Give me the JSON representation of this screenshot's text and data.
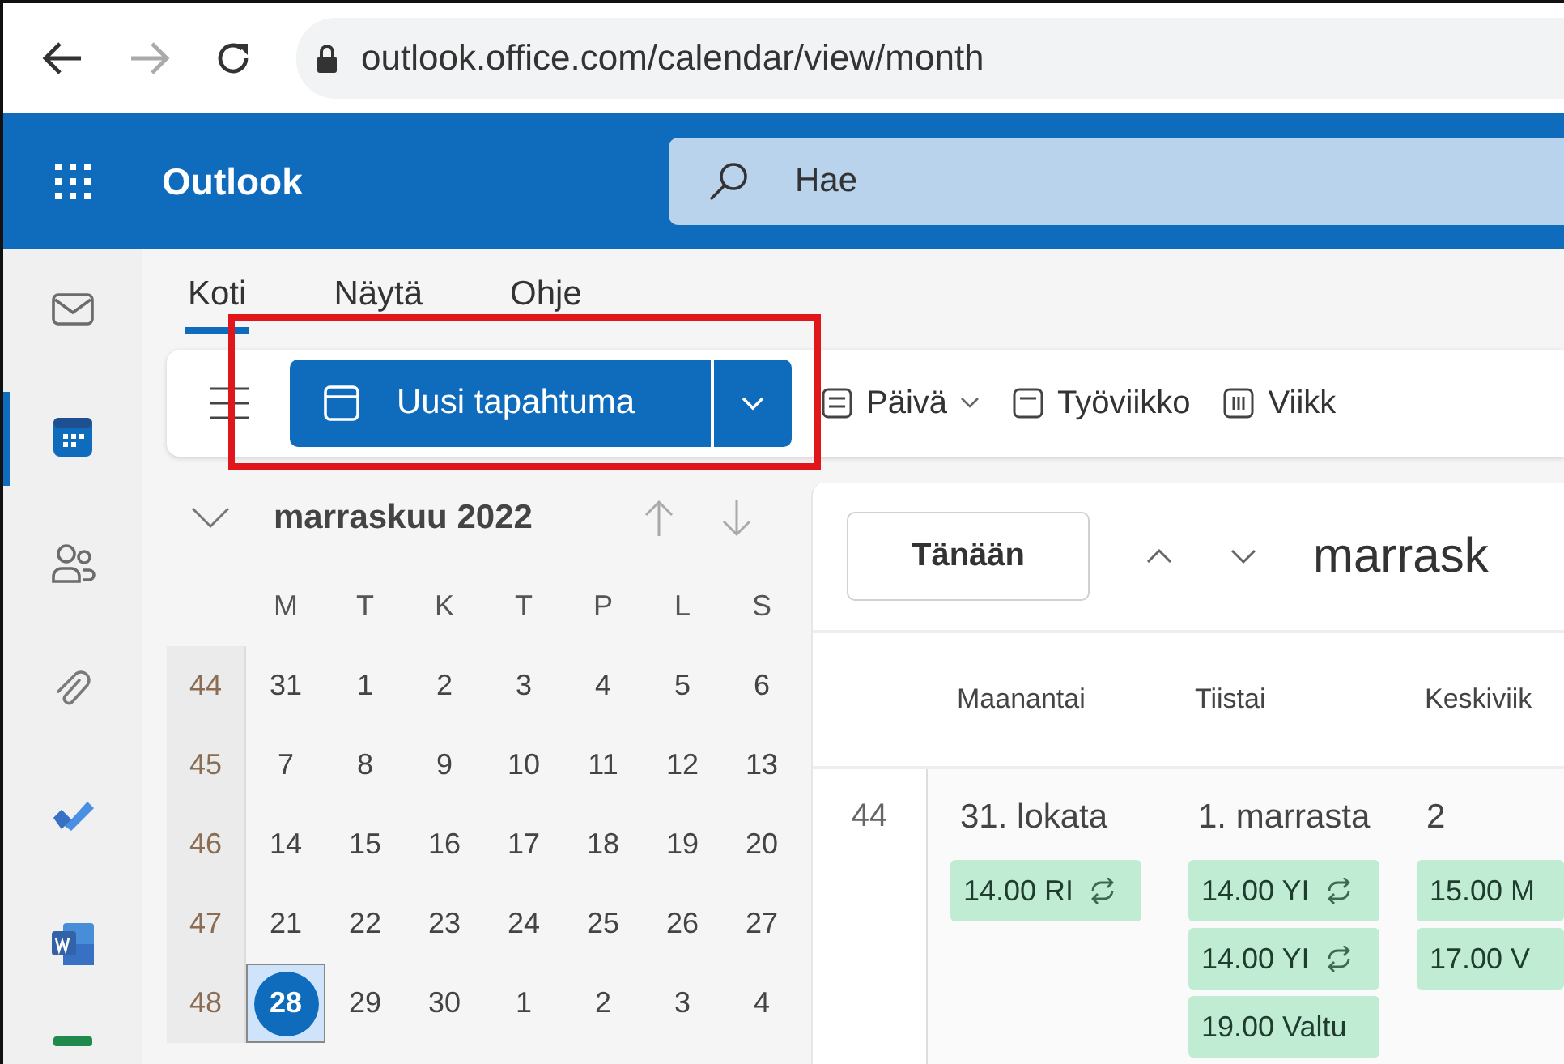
{
  "browser": {
    "url": "outlook.office.com/calendar/view/month"
  },
  "header": {
    "app_name": "Outlook",
    "search": {
      "placeholder": "Hae"
    }
  },
  "rail": [
    {
      "kind": "mail",
      "selected": false
    },
    {
      "kind": "calendar",
      "selected": true
    },
    {
      "kind": "people",
      "selected": false
    },
    {
      "kind": "attach",
      "selected": false
    },
    {
      "kind": "todo",
      "selected": false
    },
    {
      "kind": "word",
      "selected": false
    }
  ],
  "tabs": [
    {
      "label": "Koti",
      "selected": true
    },
    {
      "label": "Näytä",
      "selected": false
    },
    {
      "label": "Ohje",
      "selected": false
    }
  ],
  "toolbar": {
    "new_event": "Uusi tapahtuma",
    "views": [
      {
        "label": "Päivä",
        "kind": "day",
        "dropdown": true
      },
      {
        "label": "Työviikko",
        "kind": "workweek",
        "dropdown": false
      },
      {
        "label": "Viikk",
        "kind": "week",
        "dropdown": false
      }
    ]
  },
  "mini_calendar": {
    "title": "marraskuu 2022",
    "weekdays": [
      "M",
      "T",
      "K",
      "T",
      "P",
      "L",
      "S"
    ],
    "weeks": [
      {
        "number": "44",
        "days": [
          {
            "day": "31",
            "selected": false
          },
          {
            "day": "1",
            "selected": false
          },
          {
            "day": "2",
            "selected": false
          },
          {
            "day": "3",
            "selected": false
          },
          {
            "day": "4",
            "selected": false
          },
          {
            "day": "5",
            "selected": false
          },
          {
            "day": "6",
            "selected": false
          }
        ]
      },
      {
        "number": "45",
        "days": [
          {
            "day": "7",
            "selected": false
          },
          {
            "day": "8",
            "selected": false
          },
          {
            "day": "9",
            "selected": false
          },
          {
            "day": "10",
            "selected": false
          },
          {
            "day": "11",
            "selected": false
          },
          {
            "day": "12",
            "selected": false
          },
          {
            "day": "13",
            "selected": false
          }
        ]
      },
      {
        "number": "46",
        "days": [
          {
            "day": "14",
            "selected": false
          },
          {
            "day": "15",
            "selected": false
          },
          {
            "day": "16",
            "selected": false
          },
          {
            "day": "17",
            "selected": false
          },
          {
            "day": "18",
            "selected": false
          },
          {
            "day": "19",
            "selected": false
          },
          {
            "day": "20",
            "selected": false
          }
        ]
      },
      {
        "number": "47",
        "days": [
          {
            "day": "21",
            "selected": false
          },
          {
            "day": "22",
            "selected": false
          },
          {
            "day": "23",
            "selected": false
          },
          {
            "day": "24",
            "selected": false
          },
          {
            "day": "25",
            "selected": false
          },
          {
            "day": "26",
            "selected": false
          },
          {
            "day": "27",
            "selected": false
          }
        ]
      },
      {
        "number": "48",
        "days": [
          {
            "day": "28",
            "selected": true
          },
          {
            "day": "29",
            "selected": false
          },
          {
            "day": "30",
            "selected": false
          },
          {
            "day": "1",
            "selected": false
          },
          {
            "day": "2",
            "selected": false
          },
          {
            "day": "3",
            "selected": false
          },
          {
            "day": "4",
            "selected": false
          }
        ]
      }
    ]
  },
  "calendar": {
    "today_button": "Tänään",
    "title": "marrask",
    "day_headers": [
      "Maanantai",
      "Tiistai",
      "Keskiviik"
    ],
    "week": {
      "number": "44",
      "days": [
        {
          "date": "31. lokata",
          "events": [
            {
              "text": "14.00 RI",
              "recurring": true
            }
          ]
        },
        {
          "date": "1. marrasta",
          "events": [
            {
              "text": "14.00 YI",
              "recurring": true
            },
            {
              "text": "14.00 YI",
              "recurring": true
            },
            {
              "text": "19.00 Valtu",
              "recurring": false
            }
          ]
        },
        {
          "date": "2",
          "events": [
            {
              "text": "15.00 M",
              "recurring": false
            },
            {
              "text": "17.00 V",
              "recurring": false
            }
          ]
        }
      ]
    }
  }
}
